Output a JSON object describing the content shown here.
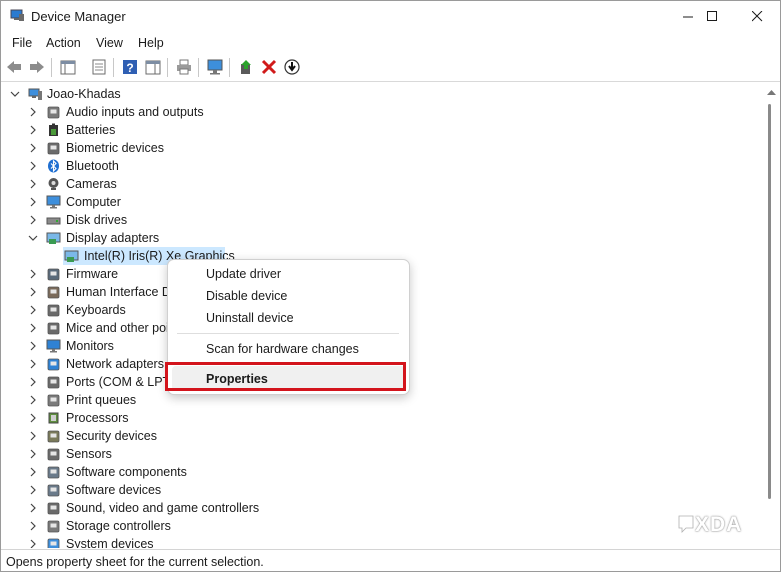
{
  "window": {
    "title": "Device Manager"
  },
  "menu": [
    "File",
    "Action",
    "View",
    "Help"
  ],
  "tree": {
    "root": "Joao-Khadas",
    "items": [
      {
        "label": "Audio inputs and outputs",
        "icon": "speaker-icon"
      },
      {
        "label": "Batteries",
        "icon": "battery-icon"
      },
      {
        "label": "Biometric devices",
        "icon": "biometric-icon"
      },
      {
        "label": "Bluetooth",
        "icon": "bluetooth-icon"
      },
      {
        "label": "Cameras",
        "icon": "camera-icon"
      },
      {
        "label": "Computer",
        "icon": "computer-icon"
      },
      {
        "label": "Disk drives",
        "icon": "disk-drive-icon"
      },
      {
        "label": "Display adapters",
        "icon": "display-adapter-icon",
        "expanded": true
      },
      {
        "label": "Intel(R) Iris(R) Xe Graphics",
        "icon": "display-adapter-icon",
        "child": true,
        "selected": true
      },
      {
        "label": "Firmware",
        "icon": "firmware-icon"
      },
      {
        "label": "Human Interface De",
        "icon": "hid-icon"
      },
      {
        "label": "Keyboards",
        "icon": "keyboard-icon"
      },
      {
        "label": "Mice and other poi",
        "icon": "mouse-icon"
      },
      {
        "label": "Monitors",
        "icon": "monitor-icon"
      },
      {
        "label": "Network adapters",
        "icon": "network-adapter-icon"
      },
      {
        "label": "Ports (COM & LPT)",
        "icon": "port-icon"
      },
      {
        "label": "Print queues",
        "icon": "printer-icon"
      },
      {
        "label": "Processors",
        "icon": "processor-icon"
      },
      {
        "label": "Security devices",
        "icon": "security-device-icon"
      },
      {
        "label": "Sensors",
        "icon": "sensor-icon"
      },
      {
        "label": "Software components",
        "icon": "software-component-icon"
      },
      {
        "label": "Software devices",
        "icon": "software-device-icon"
      },
      {
        "label": "Sound, video and game controllers",
        "icon": "sound-controller-icon"
      },
      {
        "label": "Storage controllers",
        "icon": "storage-controller-icon"
      },
      {
        "label": "System devices",
        "icon": "system-device-icon"
      }
    ]
  },
  "context_menu": {
    "update_driver": "Update driver",
    "disable_device": "Disable device",
    "uninstall_device": "Uninstall device",
    "scan_changes": "Scan for hardware changes",
    "properties": "Properties"
  },
  "status_bar": {
    "text": "Opens property sheet for the current selection."
  },
  "watermark": "XDA",
  "colors": {
    "highlight_box": "#d3141c",
    "selection": "#cce8ff"
  }
}
